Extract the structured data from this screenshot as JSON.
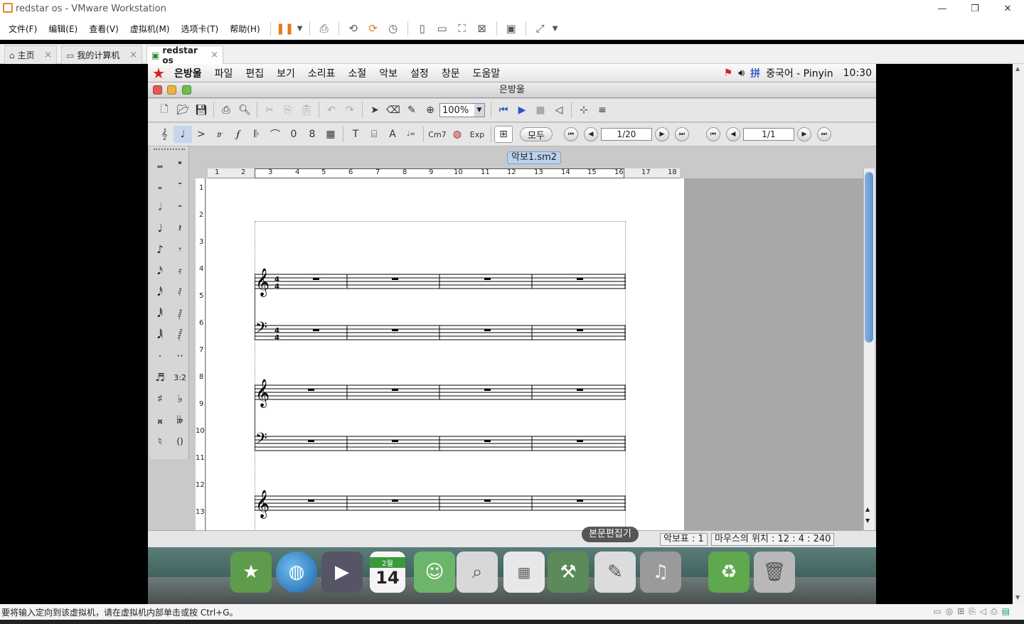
{
  "vmware": {
    "title": "redstar os - VMware Workstation",
    "menus": [
      "文件(F)",
      "编辑(E)",
      "查看(V)",
      "虚拟机(M)",
      "选项卡(T)",
      "帮助(H)"
    ],
    "tabs": [
      {
        "label": "主页",
        "icon": "home-icon"
      },
      {
        "label": "我的计算机",
        "icon": "computer-icon"
      },
      {
        "label": "redstar os",
        "icon": "vm-icon"
      }
    ],
    "status_text": "要将输入定向到该虚拟机，请在虚拟机内部单击或按 Ctrl+G。"
  },
  "guest": {
    "menus": [
      "은방울",
      "파일",
      "편집",
      "보기",
      "소리표",
      "소절",
      "악보",
      "설정",
      "창문",
      "도움말"
    ],
    "tray": {
      "ime": "중국어 - Pinyin",
      "clock": "10:30"
    },
    "app_title": "은방울",
    "zoom": "100%",
    "all_button": "모두",
    "page_counter": "1/20",
    "page_counter2": "1/1",
    "text_tool": "T",
    "chord_label": "Cm7",
    "exp_label": "Exp",
    "doc_tab": "악보1.sm2",
    "ruler_h": [
      "1",
      "2",
      "3",
      "4",
      "5",
      "6",
      "7",
      "8",
      "9",
      "10",
      "11",
      "12",
      "13",
      "14",
      "15",
      "16",
      "17",
      "18"
    ],
    "ruler_v": [
      "1",
      "2",
      "3",
      "4",
      "5",
      "6",
      "7",
      "8",
      "9",
      "10",
      "11",
      "12",
      "13"
    ],
    "palette_tuplet": "3:2",
    "status": {
      "staff": "악보표 : 1",
      "mouse": "마우스의 위치 : 12 : 4 : 240"
    },
    "dock_tooltip": "본문편집기",
    "calendar": {
      "month": "2월",
      "day": "14"
    }
  }
}
